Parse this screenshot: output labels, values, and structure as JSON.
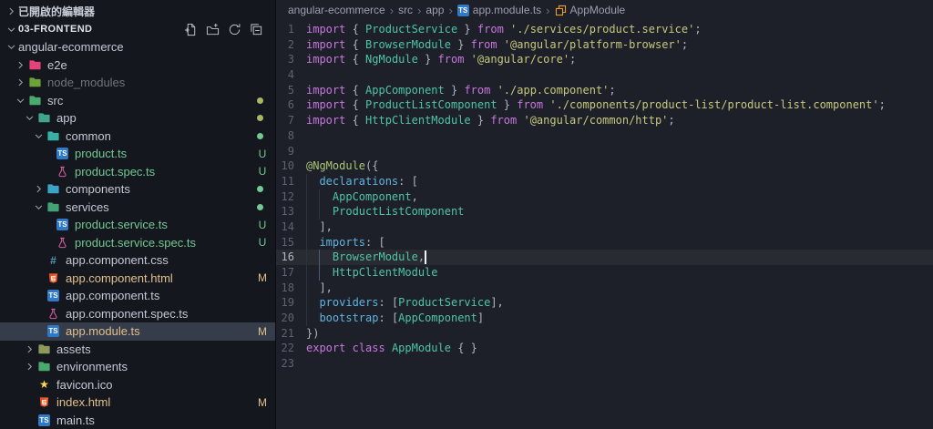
{
  "colors": {
    "editor_bg": "#1e2029",
    "sidebar_bg": "#15171e",
    "divider": "#0c0d12",
    "selection": "#353c4a",
    "untracked": "#73c991",
    "modified": "#e2c08d",
    "keyword": "#c678dd",
    "type": "#4fc4a7",
    "string": "#c5c97d",
    "property": "#5fb4e0",
    "decorator": "#a8c672",
    "punct": "#aeb5c2",
    "text_default": "#c8ccd4",
    "cursor": "#f2f3f5",
    "ts_icon_bg": "#3178c6",
    "html_icon": "#e44d26",
    "css_icon": "#519aba",
    "star_icon": "#ffd757",
    "flask_icon": "#d45d9e",
    "class_symbol": "#ee9d28"
  },
  "sidebar": {
    "open_editors": {
      "label": "已開啟的編輯器",
      "chevron": "chevron-right-icon"
    },
    "project": {
      "label": "03-FRONTEND",
      "chevron": "chevron-down-icon",
      "actions": [
        "new-file-icon",
        "new-folder-icon",
        "refresh-icon",
        "collapse-all-icon"
      ]
    },
    "tree": [
      {
        "label": "angular-ecommerce",
        "level": 0,
        "chevron": "down",
        "icon": "none"
      },
      {
        "label": "e2e",
        "level": 1,
        "chevron": "right",
        "icon": "folder",
        "iconColor": "#e5427a"
      },
      {
        "label": "node_modules",
        "level": 1,
        "chevron": "right",
        "icon": "folder",
        "iconColor": "#6ca339",
        "color": "ignored"
      },
      {
        "label": "src",
        "level": 1,
        "chevron": "down",
        "icon": "folder",
        "iconColor": "#4aa96c",
        "dot": true,
        "dotColor": "#a9b665"
      },
      {
        "label": "app",
        "level": 2,
        "chevron": "down",
        "icon": "folder",
        "iconColor": "#41a58d",
        "dot": true,
        "dotColor": "#a9b665"
      },
      {
        "label": "common",
        "level": 3,
        "chevron": "down",
        "icon": "folder",
        "iconColor": "#39b0a6",
        "dot": true
      },
      {
        "label": "product.ts",
        "level": 4,
        "icon": "ts",
        "badge": "U",
        "color": "untracked"
      },
      {
        "label": "product.spec.ts",
        "level": 4,
        "icon": "flask",
        "badge": "U",
        "color": "untracked"
      },
      {
        "label": "components",
        "level": 3,
        "chevron": "right",
        "icon": "folder",
        "iconColor": "#3ba3c4",
        "dot": true
      },
      {
        "label": "services",
        "level": 3,
        "chevron": "down",
        "icon": "folder",
        "iconColor": "#44a075",
        "dot": true
      },
      {
        "label": "product.service.ts",
        "level": 4,
        "icon": "ts",
        "badge": "U",
        "color": "untracked"
      },
      {
        "label": "product.service.spec.ts",
        "level": 4,
        "icon": "flask",
        "badge": "U",
        "color": "untracked"
      },
      {
        "label": "app.component.css",
        "level": 3,
        "icon": "css"
      },
      {
        "label": "app.component.html",
        "level": 3,
        "icon": "html",
        "badge": "M",
        "color": "modified"
      },
      {
        "label": "app.component.ts",
        "level": 3,
        "icon": "ts"
      },
      {
        "label": "app.component.spec.ts",
        "level": 3,
        "icon": "flask"
      },
      {
        "label": "app.module.ts",
        "level": 3,
        "icon": "ts",
        "badge": "M",
        "color": "modified",
        "selected": true
      },
      {
        "label": "assets",
        "level": 2,
        "chevron": "right",
        "icon": "folder",
        "iconColor": "#8a9a5b"
      },
      {
        "label": "environments",
        "level": 2,
        "chevron": "right",
        "icon": "folder",
        "iconColor": "#4aa96c"
      },
      {
        "label": "favicon.ico",
        "level": 2,
        "icon": "star"
      },
      {
        "label": "index.html",
        "level": 2,
        "icon": "html",
        "badge": "M",
        "color": "modified"
      },
      {
        "label": "main.ts",
        "level": 2,
        "icon": "ts"
      }
    ]
  },
  "breadcrumb": {
    "separator": "›",
    "items": [
      {
        "label": "angular-ecommerce"
      },
      {
        "label": "src"
      },
      {
        "label": "app"
      },
      {
        "label": "app.module.ts",
        "icon": "ts"
      },
      {
        "label": "AppModule",
        "icon": "class"
      }
    ]
  },
  "editor": {
    "cursor": {
      "line": 16,
      "col": 18
    },
    "lines": [
      {
        "n": 1,
        "tokens": [
          [
            "import",
            "k"
          ],
          [
            " { ",
            "p"
          ],
          [
            "ProductService",
            "t"
          ],
          [
            " } ",
            "p"
          ],
          [
            "from",
            "k"
          ],
          [
            " ",
            "d"
          ],
          [
            "'./services/product.service'",
            "s"
          ],
          [
            ";",
            "p"
          ]
        ]
      },
      {
        "n": 2,
        "tokens": [
          [
            "import",
            "k"
          ],
          [
            " { ",
            "p"
          ],
          [
            "BrowserModule",
            "t"
          ],
          [
            " } ",
            "p"
          ],
          [
            "from",
            "k"
          ],
          [
            " ",
            "d"
          ],
          [
            "'@angular/platform-browser'",
            "s"
          ],
          [
            ";",
            "p"
          ]
        ]
      },
      {
        "n": 3,
        "tokens": [
          [
            "import",
            "k"
          ],
          [
            " { ",
            "p"
          ],
          [
            "NgModule",
            "t"
          ],
          [
            " } ",
            "p"
          ],
          [
            "from",
            "k"
          ],
          [
            " ",
            "d"
          ],
          [
            "'@angular/core'",
            "s"
          ],
          [
            ";",
            "p"
          ]
        ]
      },
      {
        "n": 4,
        "tokens": []
      },
      {
        "n": 5,
        "tokens": [
          [
            "import",
            "k"
          ],
          [
            " { ",
            "p"
          ],
          [
            "AppComponent",
            "t"
          ],
          [
            " } ",
            "p"
          ],
          [
            "from",
            "k"
          ],
          [
            " ",
            "d"
          ],
          [
            "'./app.component'",
            "s"
          ],
          [
            ";",
            "p"
          ]
        ]
      },
      {
        "n": 6,
        "tokens": [
          [
            "import",
            "k"
          ],
          [
            " { ",
            "p"
          ],
          [
            "ProductListComponent",
            "t"
          ],
          [
            " } ",
            "p"
          ],
          [
            "from",
            "k"
          ],
          [
            " ",
            "d"
          ],
          [
            "'./components/product-list/product-list.component'",
            "s"
          ],
          [
            ";",
            "p"
          ]
        ]
      },
      {
        "n": 7,
        "tokens": [
          [
            "import",
            "k"
          ],
          [
            " { ",
            "p"
          ],
          [
            "HttpClientModule",
            "t"
          ],
          [
            " } ",
            "p"
          ],
          [
            "from",
            "k"
          ],
          [
            " ",
            "d"
          ],
          [
            "'@angular/common/http'",
            "s"
          ],
          [
            ";",
            "p"
          ]
        ]
      },
      {
        "n": 8,
        "tokens": []
      },
      {
        "n": 9,
        "tokens": []
      },
      {
        "n": 10,
        "tokens": [
          [
            "@NgModule",
            "dec"
          ],
          [
            "({",
            "p"
          ]
        ]
      },
      {
        "n": 11,
        "tokens": [
          [
            "  ",
            "d"
          ],
          [
            "declarations",
            "prop"
          ],
          [
            ": ",
            "p"
          ],
          [
            "[",
            "p"
          ]
        ]
      },
      {
        "n": 12,
        "tokens": [
          [
            "    ",
            "d"
          ],
          [
            "AppComponent",
            "t"
          ],
          [
            ",",
            "p"
          ]
        ]
      },
      {
        "n": 13,
        "tokens": [
          [
            "    ",
            "d"
          ],
          [
            "ProductListComponent",
            "t"
          ]
        ]
      },
      {
        "n": 14,
        "tokens": [
          [
            "  ],",
            "p"
          ]
        ]
      },
      {
        "n": 15,
        "tokens": [
          [
            "  ",
            "d"
          ],
          [
            "imports",
            "prop"
          ],
          [
            ": ",
            "p"
          ],
          [
            "[",
            "p"
          ]
        ]
      },
      {
        "n": 16,
        "ag": 2,
        "tokens": [
          [
            "    ",
            "d"
          ],
          [
            "BrowserModule",
            "t"
          ],
          [
            ",",
            "p"
          ]
        ]
      },
      {
        "n": 17,
        "ag": 2,
        "tokens": [
          [
            "    ",
            "d"
          ],
          [
            "HttpClientModule",
            "t"
          ]
        ]
      },
      {
        "n": 18,
        "tokens": [
          [
            "  ],",
            "p"
          ]
        ]
      },
      {
        "n": 19,
        "tokens": [
          [
            "  ",
            "d"
          ],
          [
            "providers",
            "prop"
          ],
          [
            ": ",
            "p"
          ],
          [
            "[",
            "p"
          ],
          [
            "ProductService",
            "t"
          ],
          [
            "],",
            "p"
          ]
        ]
      },
      {
        "n": 20,
        "tokens": [
          [
            "  ",
            "d"
          ],
          [
            "bootstrap",
            "prop"
          ],
          [
            ": ",
            "p"
          ],
          [
            "[",
            "p"
          ],
          [
            "AppComponent",
            "t"
          ],
          [
            "]",
            "p"
          ]
        ]
      },
      {
        "n": 21,
        "tokens": [
          [
            "})",
            "p"
          ]
        ]
      },
      {
        "n": 22,
        "tokens": [
          [
            "export",
            "k"
          ],
          [
            " ",
            "d"
          ],
          [
            "class",
            "k"
          ],
          [
            " ",
            "d"
          ],
          [
            "AppModule",
            "t"
          ],
          [
            " ",
            "d"
          ],
          [
            "{ }",
            "p"
          ]
        ]
      },
      {
        "n": 23,
        "tokens": []
      }
    ]
  }
}
